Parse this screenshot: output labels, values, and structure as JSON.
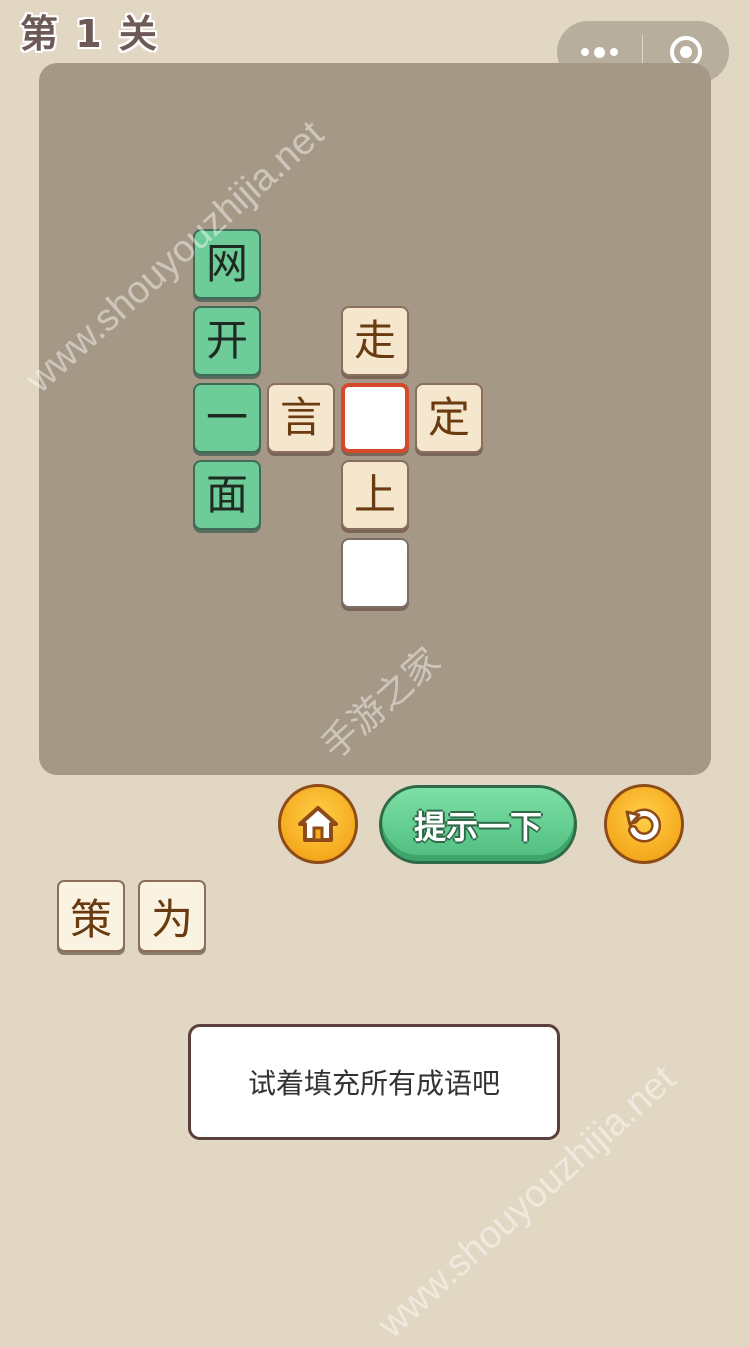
{
  "level": {
    "title": "第 1 关"
  },
  "capsule": {
    "more_icon": "more-dots-icon",
    "close_icon": "target-circle-icon"
  },
  "board": {
    "tiles": [
      {
        "char": "网",
        "style": "green"
      },
      {
        "char": "开",
        "style": "green"
      },
      {
        "char": "一",
        "style": "green"
      },
      {
        "char": "面",
        "style": "green"
      },
      {
        "char": "走",
        "style": "cream"
      },
      {
        "char": "言",
        "style": "cream"
      },
      {
        "char": "",
        "style": "selected"
      },
      {
        "char": "定",
        "style": "cream"
      },
      {
        "char": "上",
        "style": "cream"
      },
      {
        "char": "",
        "style": "blank"
      }
    ]
  },
  "controls": {
    "home_icon": "home-icon",
    "hint_label": "提示一下",
    "restart_icon": "restart-icon"
  },
  "options": [
    {
      "char": "策"
    },
    {
      "char": "为"
    }
  ],
  "toast": {
    "message": "试着填充所有成语吧"
  },
  "watermarks": {
    "top": "www.shouyouzhijia.net",
    "middle": "手游之家",
    "bottom": "www.shouyouzhijia.net"
  },
  "colors": {
    "background": "#e2d7c3",
    "board": "#a69886",
    "green_tile": "#6dcc98",
    "cream_tile": "#f5e7ce",
    "selected_border": "#d64a2c",
    "button_gold": "#f5aa1e",
    "hint_green": "#4fbd7e"
  }
}
